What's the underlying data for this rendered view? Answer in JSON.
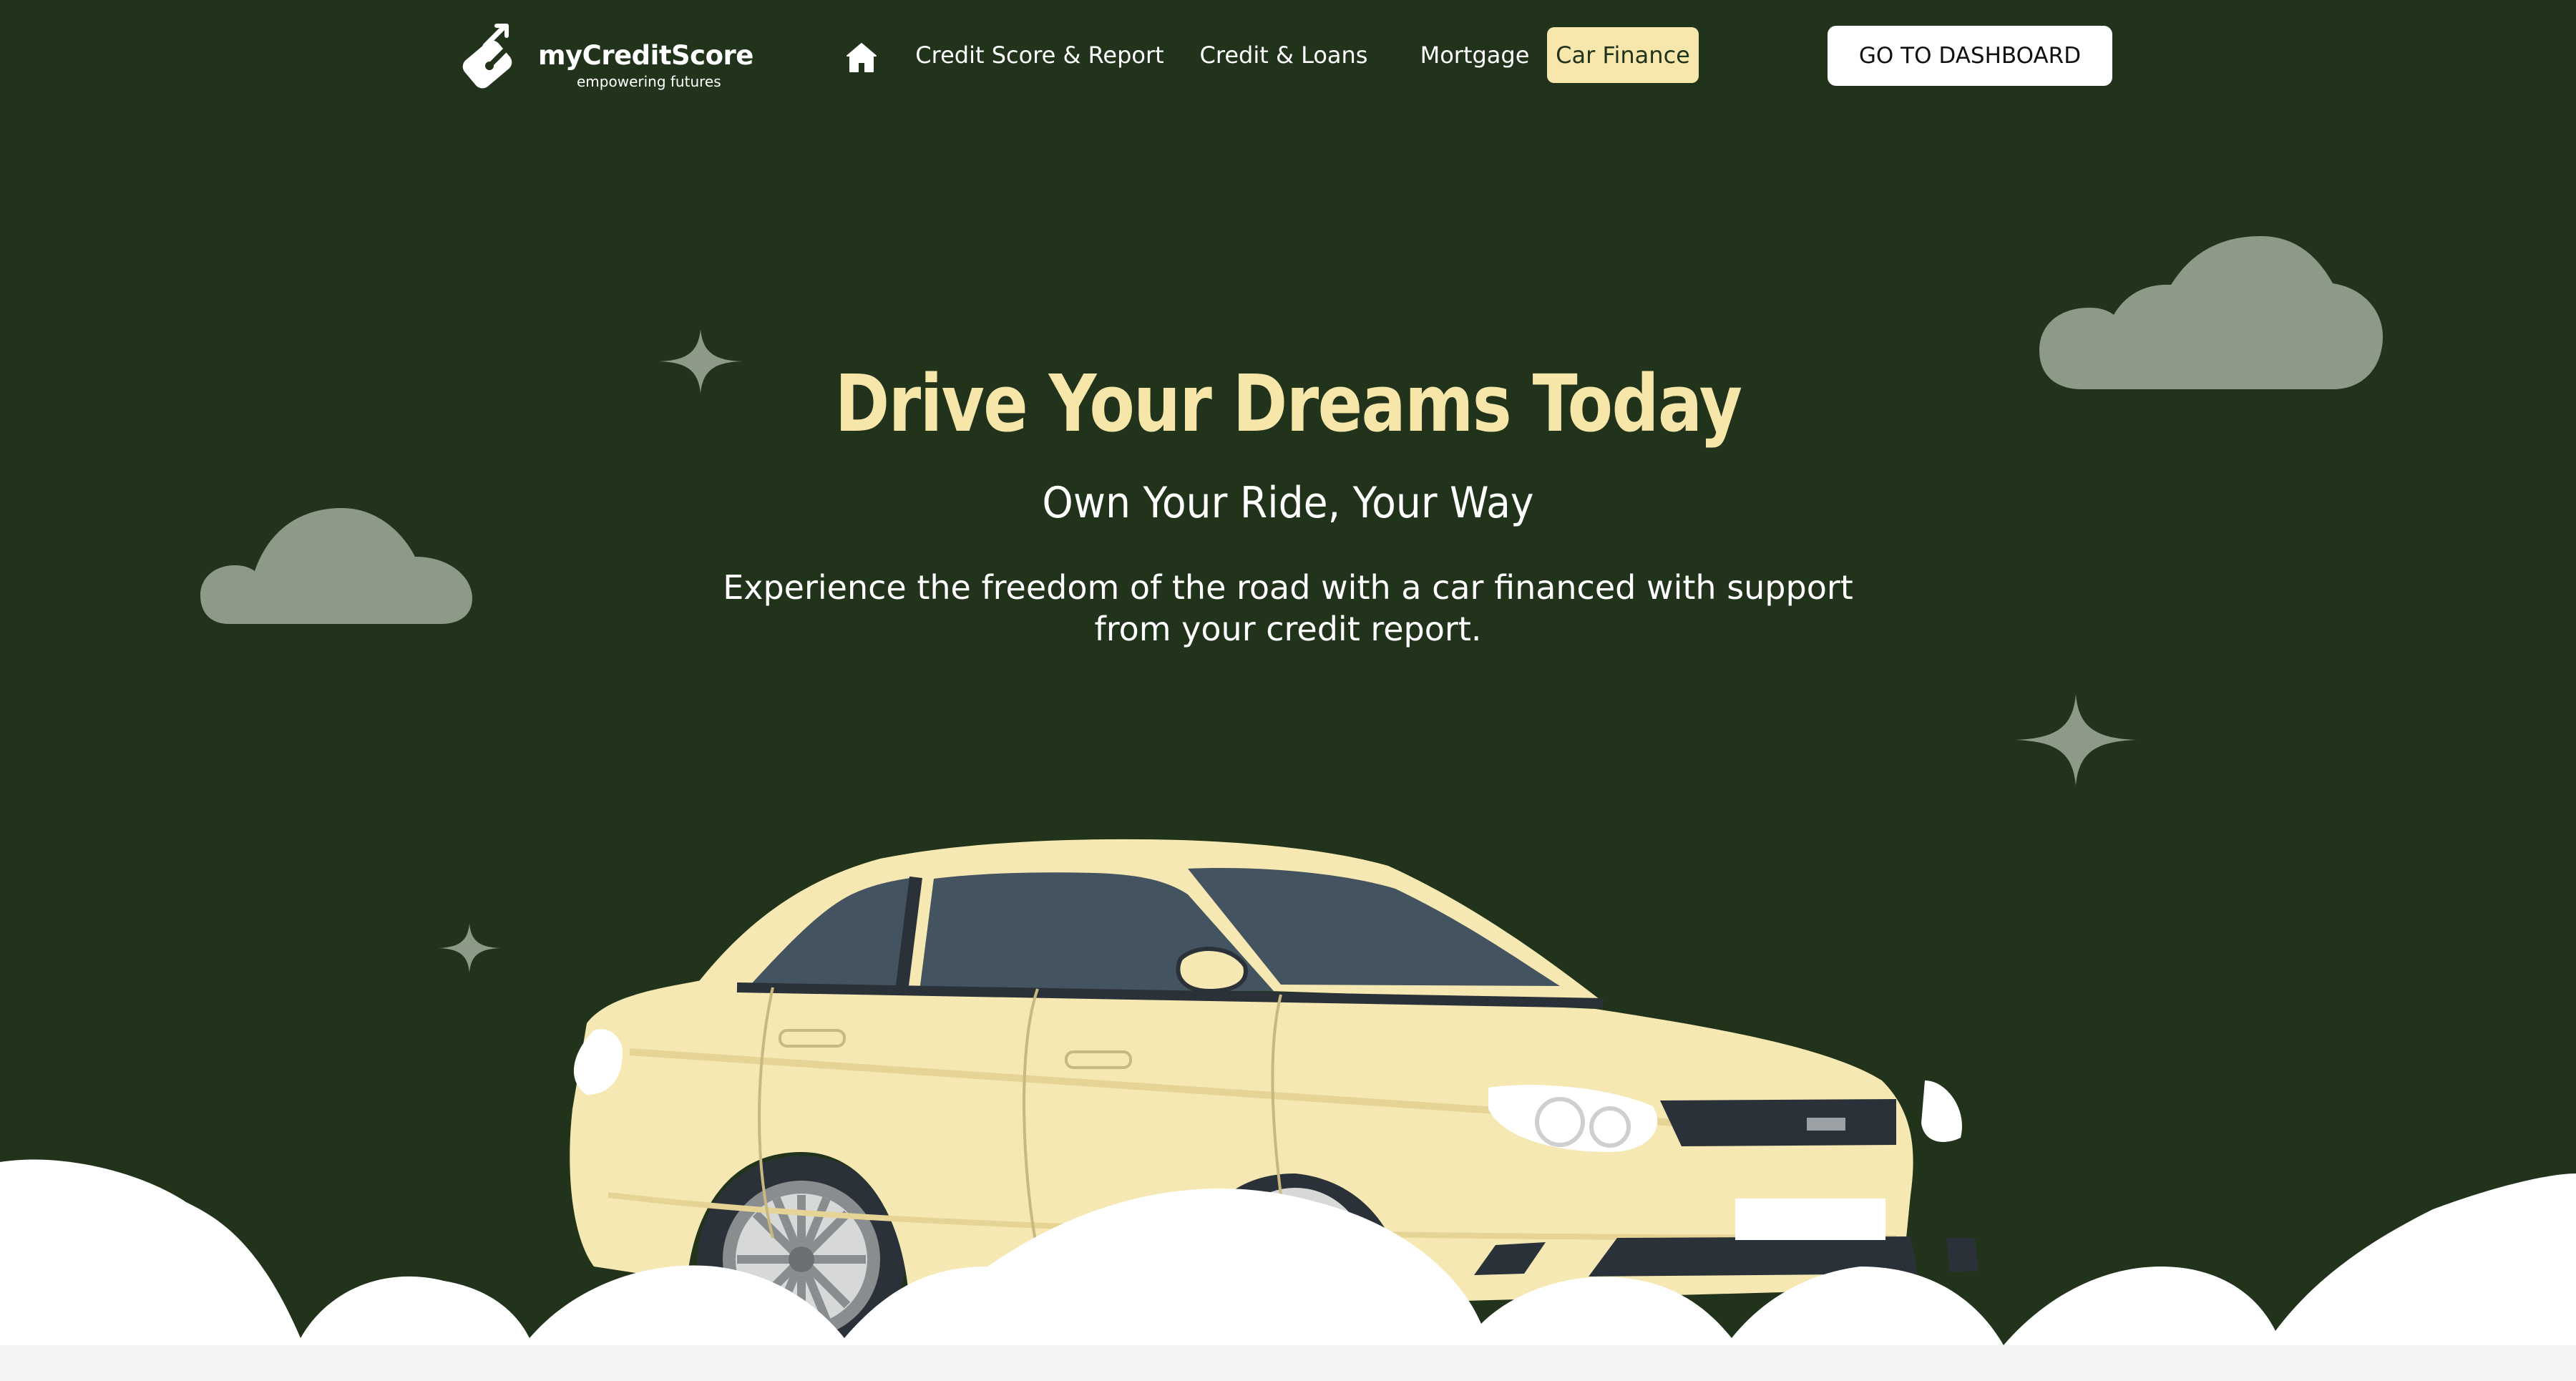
{
  "header": {
    "logo": {
      "name": "myCreditScore",
      "tagline": "empowering futures",
      "icon": "wallet-pen-logo-icon"
    },
    "nav": {
      "home_icon": "home-icon",
      "items": [
        {
          "label": "Credit Score & Report",
          "active": false
        },
        {
          "label": "Credit & Loans",
          "active": false
        },
        {
          "label": "Mortgage",
          "active": false
        },
        {
          "label": "Car Finance",
          "active": true
        }
      ]
    },
    "dashboard_button": "GO TO DASHBOARD"
  },
  "hero": {
    "title": "Drive Your Dreams Today",
    "subtitle": "Own Your Ride, Your Way",
    "description": "Experience the freedom of the road with a car financed with support from your credit report."
  },
  "illustration": {
    "car_icon": "car-illustration",
    "cloud_icon": "cloud-icon",
    "sparkle_icon": "sparkle-star-icon"
  },
  "colors": {
    "background": "#21341b",
    "accent": "#f6e6aa",
    "active_nav_bg": "#f7e7ad",
    "cloud_bg": "#8d9a88",
    "button_bg": "#ffffff"
  }
}
